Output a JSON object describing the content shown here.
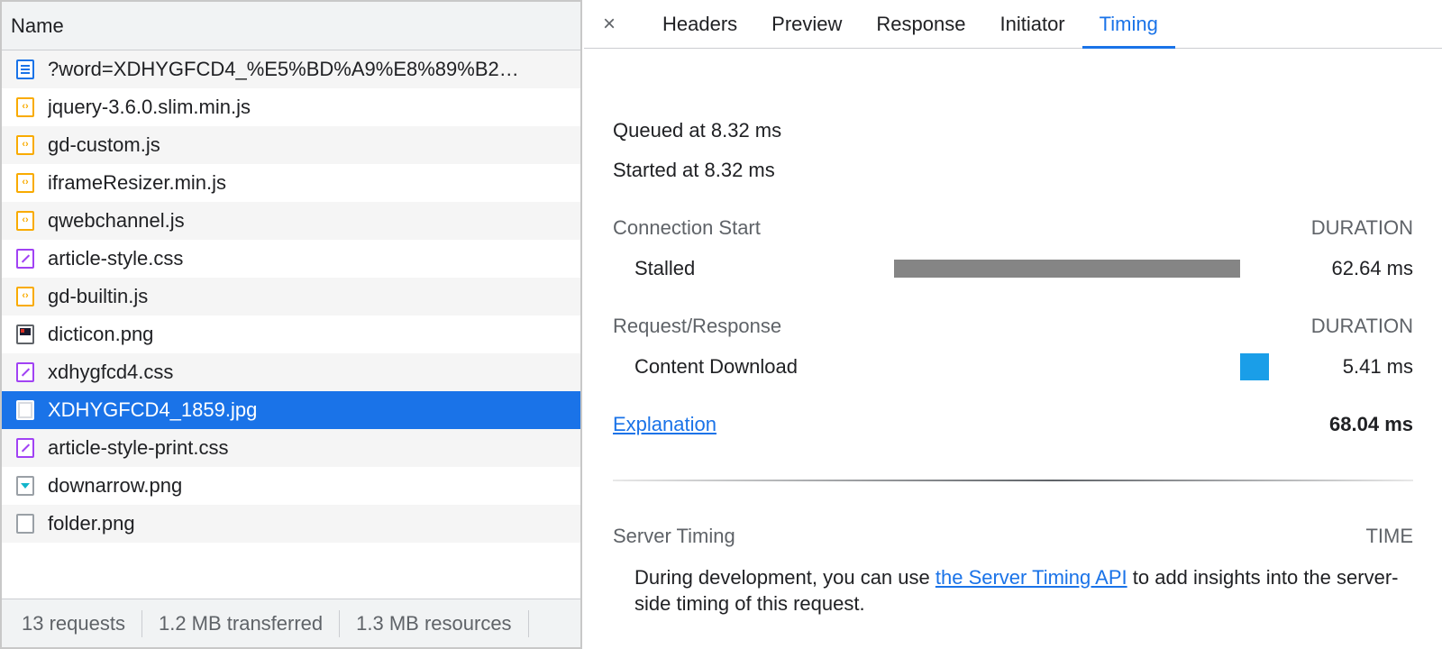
{
  "request_list": {
    "column_header": "Name",
    "rows": [
      {
        "name": "?word=XDHYGFCD4_%E5%BD%A9%E8%89%B2…",
        "type": "document",
        "icon": "document-icon"
      },
      {
        "name": "jquery-3.6.0.slim.min.js",
        "type": "script",
        "icon": "script-file-icon"
      },
      {
        "name": "gd-custom.js",
        "type": "script",
        "icon": "script-file-icon"
      },
      {
        "name": "iframeResizer.min.js",
        "type": "script",
        "icon": "script-file-icon"
      },
      {
        "name": "qwebchannel.js",
        "type": "script",
        "icon": "script-file-icon"
      },
      {
        "name": "article-style.css",
        "type": "stylesheet",
        "icon": "stylesheet-file-icon"
      },
      {
        "name": "gd-builtin.js",
        "type": "script",
        "icon": "script-file-icon"
      },
      {
        "name": "dicticon.png",
        "type": "image",
        "icon": "image-file-icon"
      },
      {
        "name": "xdhygfcd4.css",
        "type": "stylesheet",
        "icon": "stylesheet-file-icon"
      },
      {
        "name": "XDHYGFCD4_1859.jpg",
        "type": "image",
        "icon": "image-file-icon",
        "selected": true
      },
      {
        "name": "article-style-print.css",
        "type": "stylesheet",
        "icon": "stylesheet-file-icon"
      },
      {
        "name": "downarrow.png",
        "type": "image",
        "icon": "image-file-icon"
      },
      {
        "name": "folder.png",
        "type": "other",
        "icon": "generic-file-icon"
      }
    ],
    "status_bar": {
      "requests": "13 requests",
      "transferred": "1.2 MB transferred",
      "resources": "1.3 MB resources"
    }
  },
  "detail_tabs": {
    "close_icon": "close-icon",
    "tabs": [
      {
        "label": "Headers",
        "active": false
      },
      {
        "label": "Preview",
        "active": false
      },
      {
        "label": "Response",
        "active": false
      },
      {
        "label": "Initiator",
        "active": false
      },
      {
        "label": "Timing",
        "active": true
      }
    ]
  },
  "timing": {
    "queued": "Queued at 8.32 ms",
    "started": "Started at 8.32 ms",
    "connection_start": {
      "title": "Connection Start",
      "column": "DURATION",
      "rows": [
        {
          "label": "Stalled",
          "value": "62.64 ms",
          "bar_color": "#858585"
        }
      ]
    },
    "request_response": {
      "title": "Request/Response",
      "column": "DURATION",
      "rows": [
        {
          "label": "Content Download",
          "value": "5.41 ms",
          "bar_color": "#1a9ee8"
        }
      ]
    },
    "explanation_link": "Explanation",
    "total": "68.04 ms",
    "server_timing": {
      "title": "Server Timing",
      "column": "TIME",
      "text_before": "During development, you can use ",
      "link": "the Server Timing API",
      "text_after": " to add insights into the server-side timing of this request."
    }
  },
  "colors": {
    "accent": "#1a73e8",
    "selected_row": "#1a73e8",
    "stalled_bar": "#858585",
    "download_bar": "#1a9ee8"
  }
}
